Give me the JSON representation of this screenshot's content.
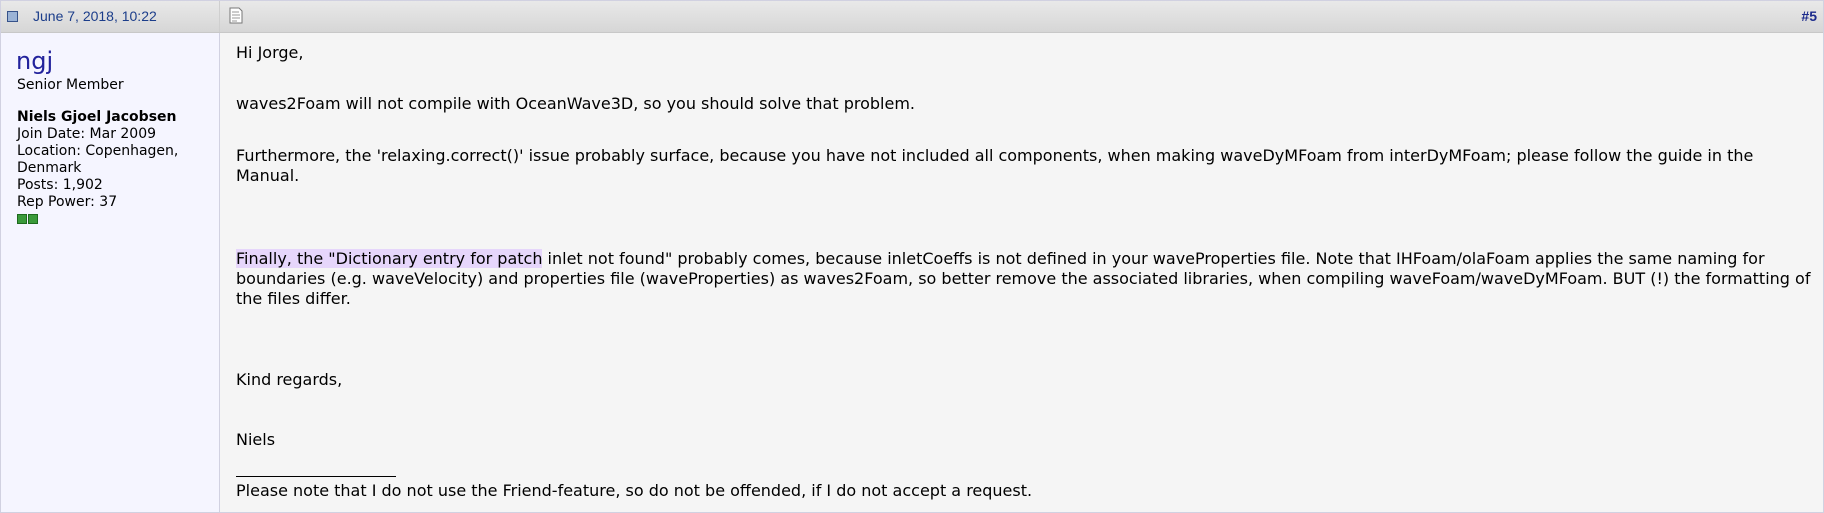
{
  "header": {
    "date": "June 7, 2018, 10:22",
    "post_number": "#5"
  },
  "user": {
    "username": "ngj",
    "title": "Senior Member",
    "real_name": "Niels Gjoel Jacobsen",
    "join_date": "Join Date: Mar 2009",
    "location": "Location: Copenhagen, Denmark",
    "posts": "Posts: 1,902",
    "rep_power": "Rep Power: 37",
    "rep_color": "#3a9a3a"
  },
  "message": {
    "greeting": "Hi Jorge,",
    "p1": "waves2Foam will not compile with OceanWave3D, so you should solve that problem.",
    "p2": "Furthermore, the 'relaxing.correct()' issue probably surface, because you have not included all components, when making waveDyMFoam from interDyMFoam; please follow the guide in the Manual.",
    "p3_highlight": "Finally, the \"Dictionary entry for patch",
    "p3_rest": " inlet not found\" probably comes, because inletCoeffs is not defined in your waveProperties file. Note that IHFoam/olaFoam applies the same naming for boundaries (e.g. waveVelocity) and properties file (waveProperties) as waves2Foam, so better remove the associated libraries, when compiling waveFoam/waveDyMFoam. BUT (!) the formatting of the files differ.",
    "closing": "Kind regards,",
    "name": "Niels",
    "signature": "Please note that I do not use the Friend-feature, so do not be offended, if I do not accept a request."
  }
}
